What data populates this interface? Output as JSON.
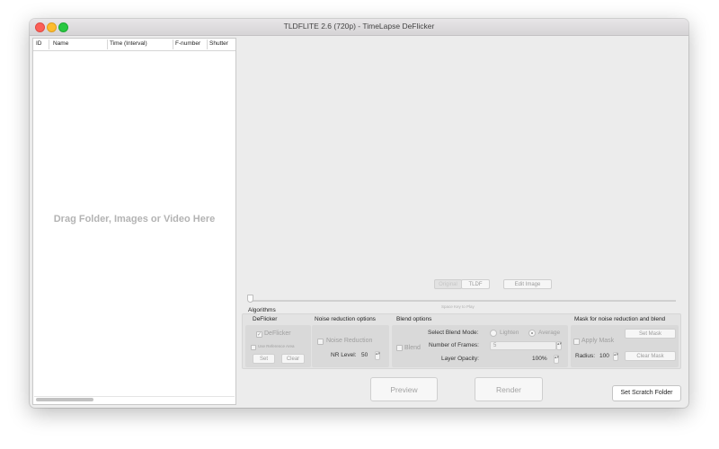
{
  "window": {
    "title": "TLDFLITE 2.6 (720p) - TimeLapse DeFlicker"
  },
  "file_table": {
    "columns": [
      "ID",
      "Name",
      "Time (Interval)",
      "F-number",
      "Shutter"
    ],
    "rows": [],
    "drop_message": "Drag Folder, Images or Video Here"
  },
  "preview": {
    "view_segment": {
      "options": [
        "Original",
        "TLDF"
      ],
      "selected": "Original"
    },
    "edit_image_label": "Edit Image",
    "slider_hint": "Space Key to Play",
    "slider_value": 0
  },
  "algorithms": {
    "label": "Algorithms",
    "deflicker": {
      "title": "DeFlicker",
      "checkbox_label": "DeFlicker",
      "checked": true,
      "use_reference_label": "Use Reference Area",
      "set_label": "Set",
      "clear_label": "Clear"
    },
    "noise": {
      "title": "Noise reduction options",
      "checkbox_label": "Noise Reduction",
      "nr_level_label": "NR Level:",
      "nr_level_value": "50"
    },
    "blend": {
      "title": "Blend options",
      "checkbox_label": "Blend",
      "mode_label": "Select Blend Mode:",
      "mode_options": [
        "Lighten",
        "Average"
      ],
      "mode_selected": "Average",
      "frames_label": "Number of Frames:",
      "frames_value": "5",
      "opacity_label": "Layer Opacity:",
      "opacity_value": "100%"
    },
    "mask": {
      "title": "Mask for noise reduction and blend",
      "checkbox_label": "Apply Mask",
      "set_mask_label": "Set Mask",
      "radius_label": "Radius:",
      "radius_value": "100",
      "clear_mask_label": "Clear Mask"
    }
  },
  "actions": {
    "preview_label": "Preview",
    "render_label": "Render",
    "scratch_label": "Set Scratch Folder"
  },
  "colors": {
    "disabled_text": "#9f9f9f",
    "panel_bg": "#e3e3e3",
    "drop_text": "#b3b3b3"
  }
}
